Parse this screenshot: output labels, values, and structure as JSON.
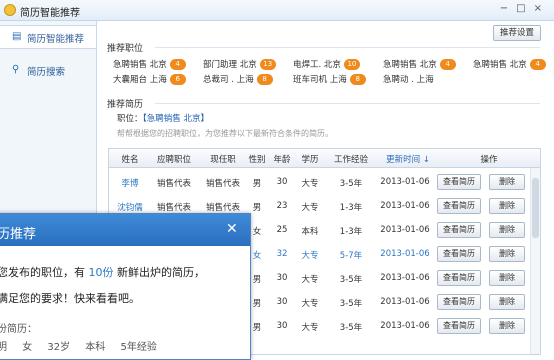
{
  "app": {
    "title": "简历智能推荐"
  },
  "sidebar": {
    "items": [
      {
        "label": "简历智能推荐",
        "icon": "document-icon",
        "active": true
      },
      {
        "label": "简历搜索",
        "icon": "search-icon",
        "active": false
      }
    ]
  },
  "header": {
    "settings_button": "推荐设置"
  },
  "jobs_section": {
    "title": "推荐职位",
    "jobs": [
      {
        "name": "急聘销售 北京",
        "count": "4"
      },
      {
        "name": "部门助理 北京",
        "count": "13"
      },
      {
        "name": "电焊工. 北京",
        "count": "10"
      },
      {
        "name": "急聘销售 北京",
        "count": "4"
      },
      {
        "name": "急聘销售 北京",
        "count": "4"
      },
      {
        "name": "大囊厢台 上海",
        "count": "6"
      },
      {
        "name": "总裁司 . 上海",
        "count": "8"
      },
      {
        "name": "班车司机 上海",
        "count": "8"
      },
      {
        "name": "急聘动 . 上海",
        "count": ""
      }
    ]
  },
  "resume_section": {
    "title": "推荐简历",
    "position_label": "职位：",
    "position_value": "【急聘销售  北京】",
    "hint": "帮帮根据您的招聘职位，为您推荐以下最新符合条件的简历。"
  },
  "table": {
    "headers": [
      "姓名",
      "应聘职位",
      "现任职",
      "性别",
      "年龄",
      "学历",
      "工作经验",
      "更新时间 ↓",
      "操作"
    ],
    "rows": [
      {
        "name": "李博",
        "apply": "销售代表",
        "current": "销售代表",
        "gender": "男",
        "age": "30",
        "edu": "大专",
        "exp": "3-5年",
        "date": "2013-01-06",
        "highlight": false
      },
      {
        "name": "沈钧儒",
        "apply": "销售代表",
        "current": "销售代表",
        "gender": "男",
        "age": "23",
        "edu": "大专",
        "exp": "1-3年",
        "date": "2013-01-06",
        "highlight": false
      },
      {
        "name": "",
        "apply": "",
        "current": "",
        "gender": "女",
        "age": "25",
        "edu": "本科",
        "exp": "1-3年",
        "date": "2013-01-06",
        "highlight": false
      },
      {
        "name": "",
        "apply": "",
        "current": "",
        "gender": "女",
        "age": "32",
        "edu": "大专",
        "exp": "5-7年",
        "date": "2013-01-06",
        "highlight": true
      },
      {
        "name": "",
        "apply": "",
        "current": "",
        "gender": "男",
        "age": "30",
        "edu": "大专",
        "exp": "3-5年",
        "date": "2013-01-06",
        "highlight": false
      },
      {
        "name": "",
        "apply": "",
        "current": "",
        "gender": "男",
        "age": "30",
        "edu": "大专",
        "exp": "3-5年",
        "date": "2013-01-06",
        "highlight": false
      },
      {
        "name": "",
        "apply": "",
        "current": "",
        "gender": "男",
        "age": "30",
        "edu": "大专",
        "exp": "3-5年",
        "date": "2013-01-06",
        "highlight": false
      }
    ],
    "view_button": "查看简历",
    "delete_button": "删除"
  },
  "popup": {
    "title": "历推荐",
    "line1_prefix": "您发布的职位，有",
    "line1_count": "10份",
    "line1_suffix": "新鲜出炉的简历，",
    "line2": "满足您的要求！快来看看吧。",
    "sub_label": "份简历：",
    "profile": [
      "明",
      "女",
      "32岁",
      "本科",
      "5年经验"
    ]
  },
  "colors": {
    "accent": "#2a78c6",
    "header_blue": "#3f8ad6",
    "badge": "#f08a1c"
  }
}
